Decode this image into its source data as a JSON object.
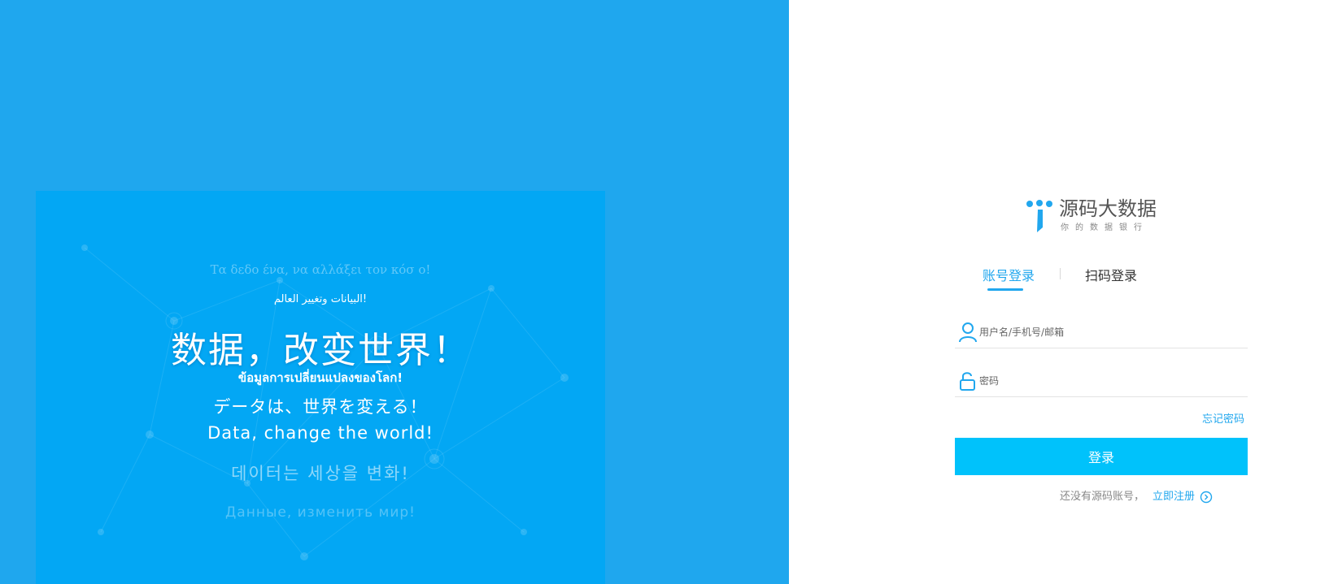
{
  "hero": {
    "greek": "Τα δεδο  ένα, να αλλάξει τον κόσ  ο!",
    "arabic": "البيانات وتغيير العالم!",
    "chinese": "数据，改变世界！",
    "thai": "ข้อมูลการเปลี่ยนแปลงของโลก!",
    "japanese": "データは、世界を変える！",
    "english": "Data, change the world!",
    "korean": "데이터는 세상을 변화!",
    "russian": "Данные, изменить мир!"
  },
  "brand": {
    "title": "源码大数据",
    "subtitle": "你的数据银行",
    "color": "#21a7ee"
  },
  "tabs": {
    "account": "账号登录",
    "qr": "扫码登录"
  },
  "form": {
    "username_placeholder": "用户名/手机号/邮箱",
    "password_placeholder": "密码",
    "forgot": "忘记密码",
    "login": "登录",
    "no_account": "还没有源码账号，",
    "register": "立即注册"
  },
  "colors": {
    "left_bg": "#1fa7ee",
    "hero_bg": "#03a7f4",
    "button": "#00c2fb",
    "accent": "#21a7ee"
  },
  "icons": {
    "user": "user-icon",
    "lock": "lock-icon",
    "arrow": "chevron-right-circle-icon"
  }
}
